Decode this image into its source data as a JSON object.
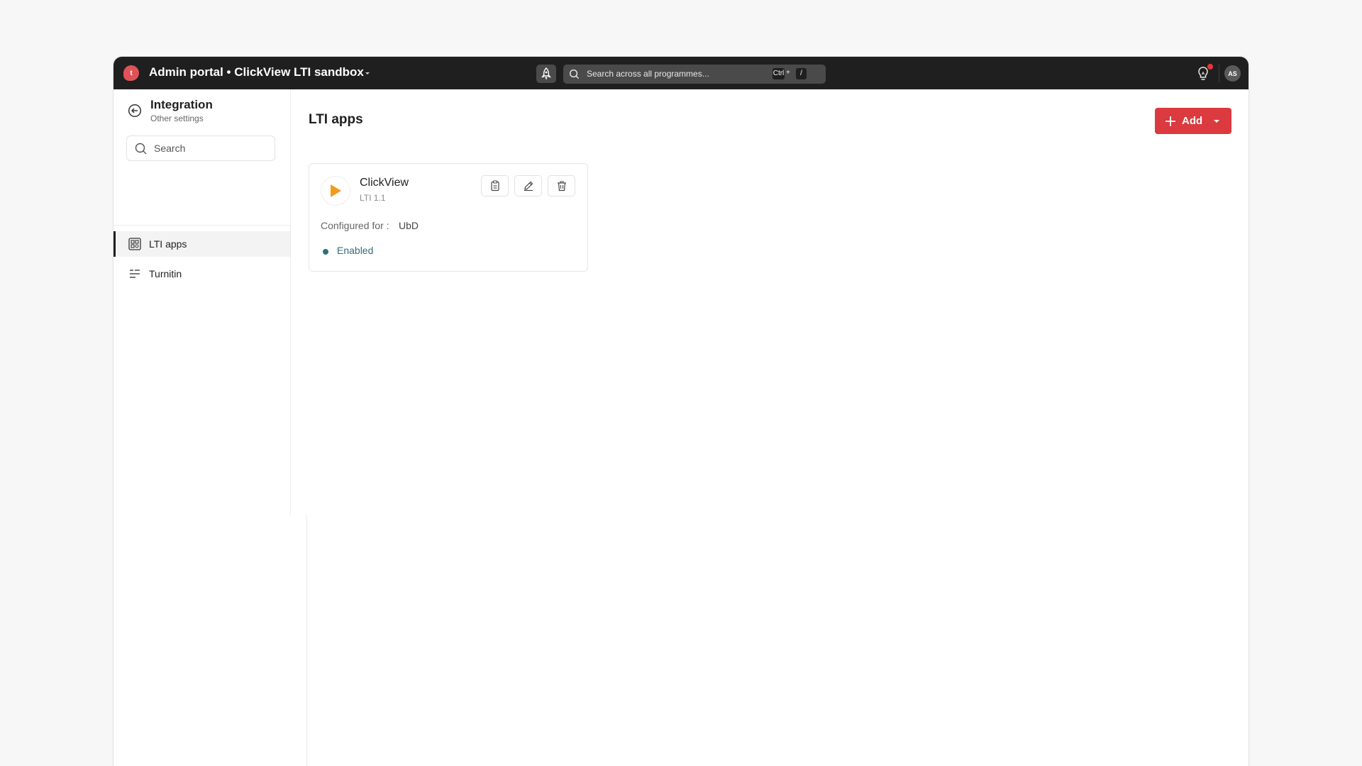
{
  "header": {
    "logo_letter": "t",
    "app_title": "Admin portal • ClickView LTI sandbox",
    "search_placeholder": "Search across all programmes...",
    "shortcut_ctrl": "Ctrl",
    "shortcut_plus": "+",
    "shortcut_key": "/",
    "avatar_initials": "AS",
    "has_notification": true
  },
  "sidebar": {
    "title": "Integration",
    "subtitle": "Other settings",
    "search_placeholder": "Search",
    "items": [
      {
        "label": "LTI apps",
        "icon": "apps-grid-icon",
        "active": true
      },
      {
        "label": "Turnitin",
        "icon": "filter-lines-icon",
        "active": false
      }
    ]
  },
  "main": {
    "title": "LTI apps",
    "add_label": "Add",
    "apps": [
      {
        "name": "ClickView",
        "version": "LTI 1.1",
        "configured_label": "Configured for :",
        "configured_value": "UbD",
        "status": "Enabled"
      }
    ]
  },
  "colors": {
    "topbar": "#1f1f1f",
    "accent_red": "#db3a3f",
    "status_teal": "#2f6f7a",
    "clickview_orange": "#f39a1e"
  }
}
